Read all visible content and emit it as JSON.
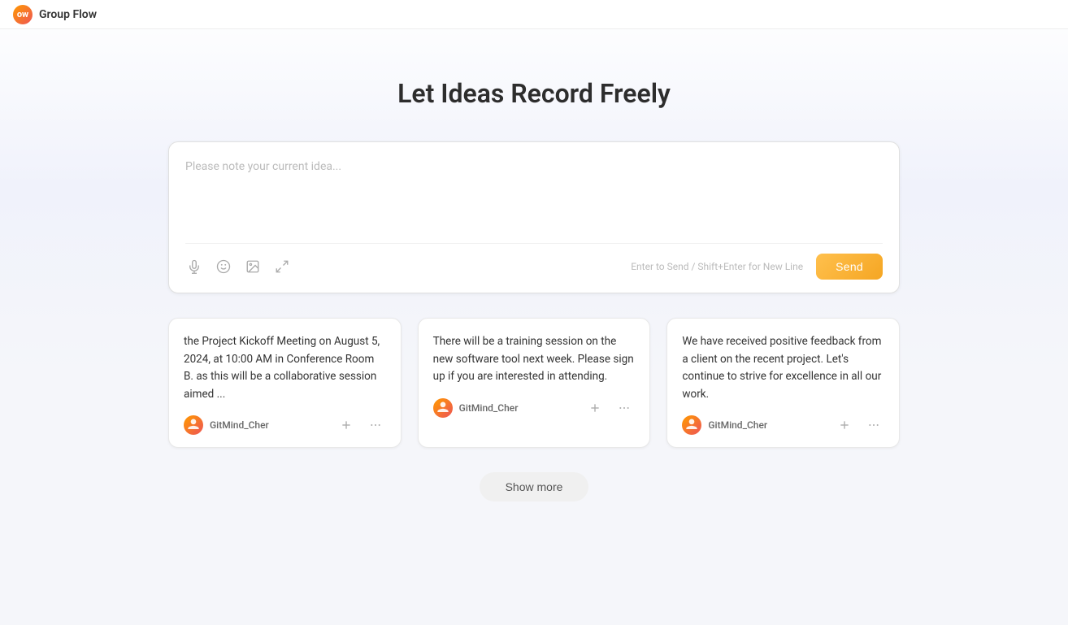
{
  "topbar": {
    "logo_text": "ow",
    "app_name": "Group Flow"
  },
  "hero": {
    "title": "Let Ideas Record Freely"
  },
  "input_area": {
    "placeholder": "Please note your current idea...",
    "keyboard_hint": "Enter to Send / Shift+Enter for New Line",
    "send_label": "Send",
    "icons": {
      "mic": "🎤",
      "emoji": "🙂",
      "image": "🖼",
      "expand": "⤢"
    }
  },
  "cards": [
    {
      "id": 1,
      "text": "the Project Kickoff Meeting on August 5, 2024, at 10:00 AM in Conference Room B. as this will be a collaborative session aimed ...",
      "author": "GitMind_Cher"
    },
    {
      "id": 2,
      "text": "There will be a training session on the new software tool next week. Please sign up if you are interested in attending.",
      "author": "GitMind_Cher"
    },
    {
      "id": 3,
      "text": "We have received positive feedback from a client on the recent project. Let's continue to strive for excellence in all our work.",
      "author": "GitMind_Cher"
    }
  ],
  "show_more": {
    "label": "Show more"
  }
}
